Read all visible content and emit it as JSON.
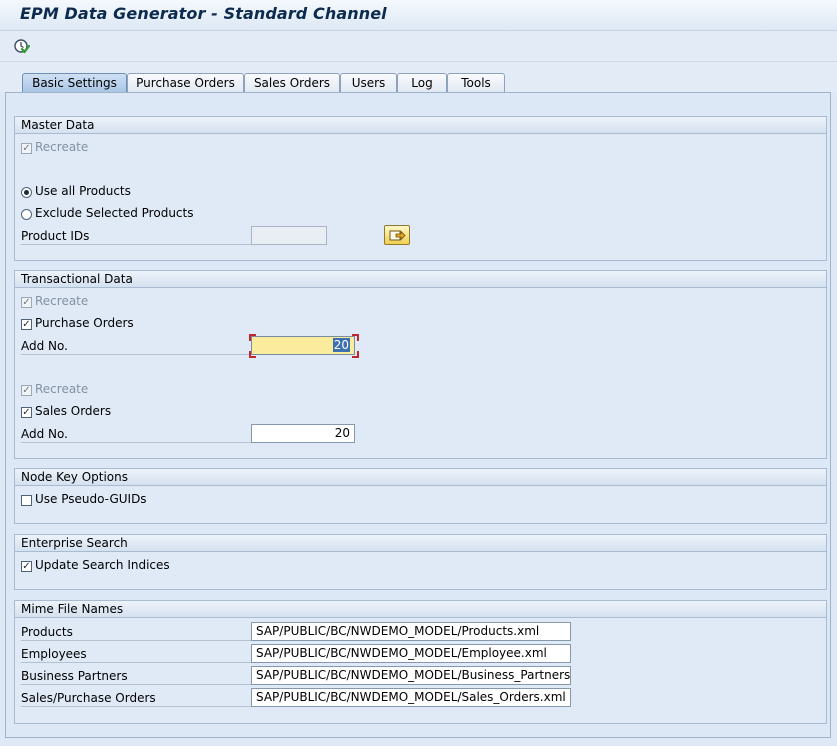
{
  "window": {
    "title": "EPM Data Generator - Standard Channel"
  },
  "toolbar": {
    "execute_icon": "execute-clock-icon"
  },
  "tabs": [
    {
      "label": "Basic Settings",
      "active": true
    },
    {
      "label": "Purchase Orders",
      "active": false
    },
    {
      "label": "Sales Orders",
      "active": false
    },
    {
      "label": "Users",
      "active": false
    },
    {
      "label": "Log",
      "active": false
    },
    {
      "label": "Tools",
      "active": false
    }
  ],
  "master_data": {
    "title": "Master Data",
    "recreate_label": "Recreate",
    "recreate_checked": true,
    "use_all_label": "Use all Products",
    "use_all_selected": true,
    "exclude_label": "Exclude Selected Products",
    "exclude_selected": false,
    "product_ids_label": "Product IDs",
    "product_ids_value": "",
    "multiple_selection_icon": "multiple-selection-arrow-icon"
  },
  "transactional_data": {
    "title": "Transactional Data",
    "po_recreate_label": "Recreate",
    "po_recreate_checked": true,
    "purchase_orders_label": "Purchase Orders",
    "purchase_orders_checked": true,
    "po_add_no_label": "Add No.",
    "po_add_no_value": "20",
    "so_recreate_label": "Recreate",
    "so_recreate_checked": true,
    "sales_orders_label": "Sales Orders",
    "sales_orders_checked": true,
    "so_add_no_label": "Add No.",
    "so_add_no_value": "20"
  },
  "node_key_options": {
    "title": "Node Key Options",
    "pseudo_guids_label": "Use Pseudo-GUIDs",
    "pseudo_guids_checked": false
  },
  "enterprise_search": {
    "title": "Enterprise Search",
    "update_indices_label": "Update Search Indices",
    "update_indices_checked": true
  },
  "mime_file_names": {
    "title": "Mime File Names",
    "rows": [
      {
        "label": "Products",
        "value": "SAP/PUBLIC/BC/NWDEMO_MODEL/Products.xml"
      },
      {
        "label": "Employees",
        "value": "SAP/PUBLIC/BC/NWDEMO_MODEL/Employee.xml"
      },
      {
        "label": "Business Partners",
        "value": "SAP/PUBLIC/BC/NWDEMO_MODEL/Business_Partners.xml"
      },
      {
        "label": "Sales/Purchase Orders",
        "value": "SAP/PUBLIC/BC/NWDEMO_MODEL/Sales_Orders.xml"
      }
    ]
  },
  "colors": {
    "background": "#dfe9f5",
    "title_text": "#0d2a4f",
    "focus_field": "#fbeb9c",
    "active_tab": "#a9c6e6"
  }
}
